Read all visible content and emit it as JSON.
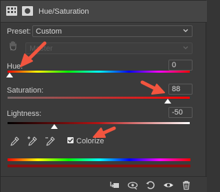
{
  "header": {
    "title": "Hue/Saturation"
  },
  "preset": {
    "label": "Preset:",
    "value": "Custom"
  },
  "channel": {
    "value": "Master"
  },
  "hue": {
    "label": "Hue:",
    "value": "0"
  },
  "saturation": {
    "label": "Saturation:",
    "value": "88"
  },
  "lightness": {
    "label": "Lightness:",
    "value": "-50"
  },
  "colorize": {
    "label": "Colorize",
    "checked": true
  },
  "colors": {
    "panel_bg": "#3b3b3b",
    "header_bg": "#454545",
    "annotation_arrow": "#f2553f",
    "bottom_bar": "#8c0f0f"
  }
}
